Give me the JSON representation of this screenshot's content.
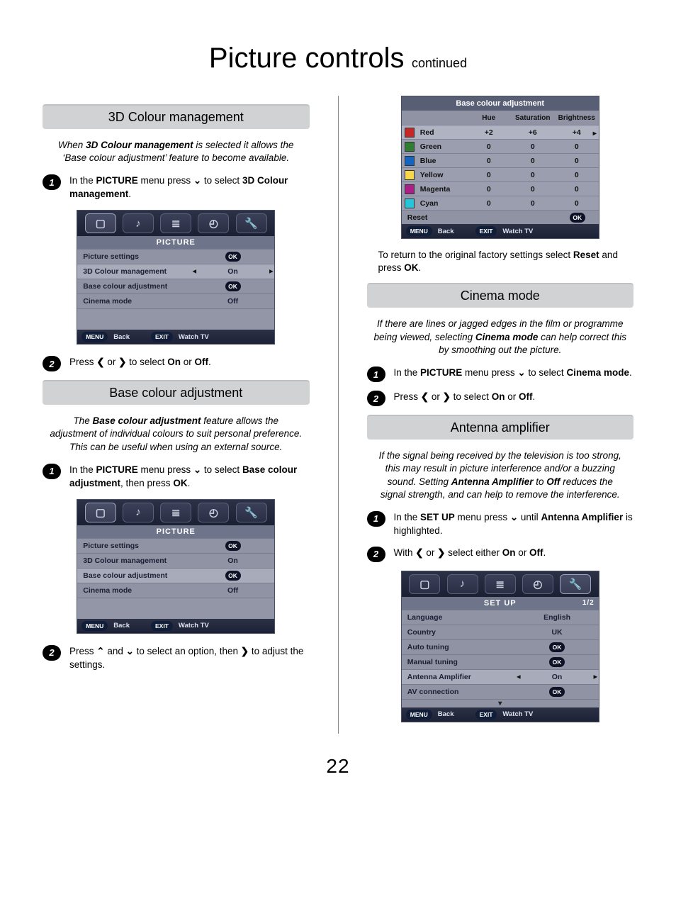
{
  "page": {
    "title_main": "Picture controls",
    "title_sub": "continued",
    "number": "22"
  },
  "sec_3d": {
    "heading": "3D Colour management",
    "intro_a": "When ",
    "intro_b": "3D Colour management",
    "intro_c": " is selected it allows the ‘Base colour adjustment’ feature to become available.",
    "step1_a": "In the ",
    "step1_b": "PICTURE",
    "step1_c": " menu press ",
    "step1_d": " to select ",
    "step1_e": "3D Colour management",
    "step1_f": ".",
    "step2_a": "Press ",
    "step2_b": " or ",
    "step2_c": " to select ",
    "step2_d": "On",
    "step2_e": " or ",
    "step2_f": "Off",
    "step2_g": "."
  },
  "sec_base": {
    "heading": "Base colour adjustment",
    "intro_a": "The ",
    "intro_b": "Base colour adjustment",
    "intro_c": " feature allows the adjustment of individual colours to suit personal preference. This can be useful when using an external source.",
    "step1_a": "In the ",
    "step1_b": "PICTURE",
    "step1_c": " menu press ",
    "step1_d": " to select ",
    "step1_e": "Base colour adjustment",
    "step1_f": ", then press ",
    "step1_g": "OK",
    "step1_h": ".",
    "step2_a": "Press ",
    "step2_b": " and ",
    "step2_c": " to select an option, then ",
    "step2_d": " to adjust the settings."
  },
  "sec_return": {
    "a": "To return to the original factory settings select ",
    "b": "Reset",
    "c": " and press ",
    "d": "OK",
    "e": "."
  },
  "sec_cinema": {
    "heading": "Cinema mode",
    "intro_a": "If there are lines or jagged edges in the film or programme being viewed, selecting ",
    "intro_b": "Cinema mode",
    "intro_c": " can help correct this by smoothing out the picture.",
    "step1_a": "In the ",
    "step1_b": "PICTURE",
    "step1_c": " menu press ",
    "step1_d": " to select ",
    "step1_e": "Cinema mode",
    "step1_f": ".",
    "step2_a": "Press ",
    "step2_b": " or ",
    "step2_c": " to select ",
    "step2_d": "On",
    "step2_e": " or ",
    "step2_f": "Off",
    "step2_g": "."
  },
  "sec_ant": {
    "heading": "Antenna amplifier",
    "intro_a": "If the signal being received by the television is too strong, this may result in picture interference and/or a buzzing sound. Setting ",
    "intro_b": "Antenna Amplifier",
    "intro_c": " to ",
    "intro_d": "Off",
    "intro_e": " reduces the signal strength, and can help to remove the interference.",
    "step1_a": "In the ",
    "step1_b": "SET UP",
    "step1_c": " menu press ",
    "step1_d": " until ",
    "step1_e": "Antenna Amplifier",
    "step1_f": " is highlighted.",
    "step2_a": "With ",
    "step2_b": " or ",
    "step2_c": " select either ",
    "step2_d": "On",
    "step2_e": " or ",
    "step2_f": "Off",
    "step2_g": "."
  },
  "osd_picture": {
    "title": "PICTURE",
    "rows": [
      {
        "label": "Picture settings",
        "value": "OK",
        "ok": true
      },
      {
        "label": "3D Colour management",
        "value": "On",
        "arrows": true,
        "selected": true
      },
      {
        "label": "Base colour adjustment",
        "value": "OK",
        "ok": true
      },
      {
        "label": "Cinema mode",
        "value": "Off"
      }
    ],
    "foot_menu": "MENU",
    "foot_back": "Back",
    "foot_exit": "EXIT",
    "foot_watch": "Watch TV"
  },
  "osd_picture2": {
    "title": "PICTURE",
    "rows": [
      {
        "label": "Picture settings",
        "value": "OK",
        "ok": true
      },
      {
        "label": "3D Colour management",
        "value": "On"
      },
      {
        "label": "Base colour adjustment",
        "value": "OK",
        "ok": true,
        "selected": true
      },
      {
        "label": "Cinema mode",
        "value": "Off"
      }
    ],
    "foot_menu": "MENU",
    "foot_back": "Back",
    "foot_exit": "EXIT",
    "foot_watch": "Watch TV"
  },
  "osd_setup": {
    "title": "SET UP",
    "page": "1/2",
    "rows": [
      {
        "label": "Language",
        "value": "English"
      },
      {
        "label": "Country",
        "value": "UK"
      },
      {
        "label": "Auto tuning",
        "value": "OK",
        "ok": true
      },
      {
        "label": "Manual tuning",
        "value": "OK",
        "ok": true
      },
      {
        "label": "Antenna Amplifier",
        "value": "On",
        "arrows": true,
        "selected": true
      },
      {
        "label": "AV connection",
        "value": "OK",
        "ok": true
      }
    ],
    "foot_menu": "MENU",
    "foot_back": "Back",
    "foot_exit": "EXIT",
    "foot_watch": "Watch TV"
  },
  "cat": {
    "title": "Base colour adjustment",
    "head": [
      "Hue",
      "Saturation",
      "Brightness"
    ],
    "rows": [
      {
        "swatch": "#c62828",
        "name": "Red",
        "hue": "+2",
        "sat": "+6",
        "bri": "+4",
        "selected": true
      },
      {
        "swatch": "#2e7d32",
        "name": "Green",
        "hue": "0",
        "sat": "0",
        "bri": "0"
      },
      {
        "swatch": "#1565c0",
        "name": "Blue",
        "hue": "0",
        "sat": "0",
        "bri": "0"
      },
      {
        "swatch": "#f9d74b",
        "name": "Yellow",
        "hue": "0",
        "sat": "0",
        "bri": "0"
      },
      {
        "swatch": "#ad1f88",
        "name": "Magenta",
        "hue": "0",
        "sat": "0",
        "bri": "0"
      },
      {
        "swatch": "#26c6da",
        "name": "Cyan",
        "hue": "0",
        "sat": "0",
        "bri": "0"
      }
    ],
    "reset": "Reset",
    "reset_ok": "OK",
    "foot_menu": "MENU",
    "foot_back": "Back",
    "foot_exit": "EXIT",
    "foot_watch": "Watch TV"
  },
  "bullets": {
    "n1": "1",
    "n2": "2"
  },
  "glyphs": {
    "down": "⌄",
    "up": "⌃",
    "left": "❮",
    "right": "❯"
  }
}
